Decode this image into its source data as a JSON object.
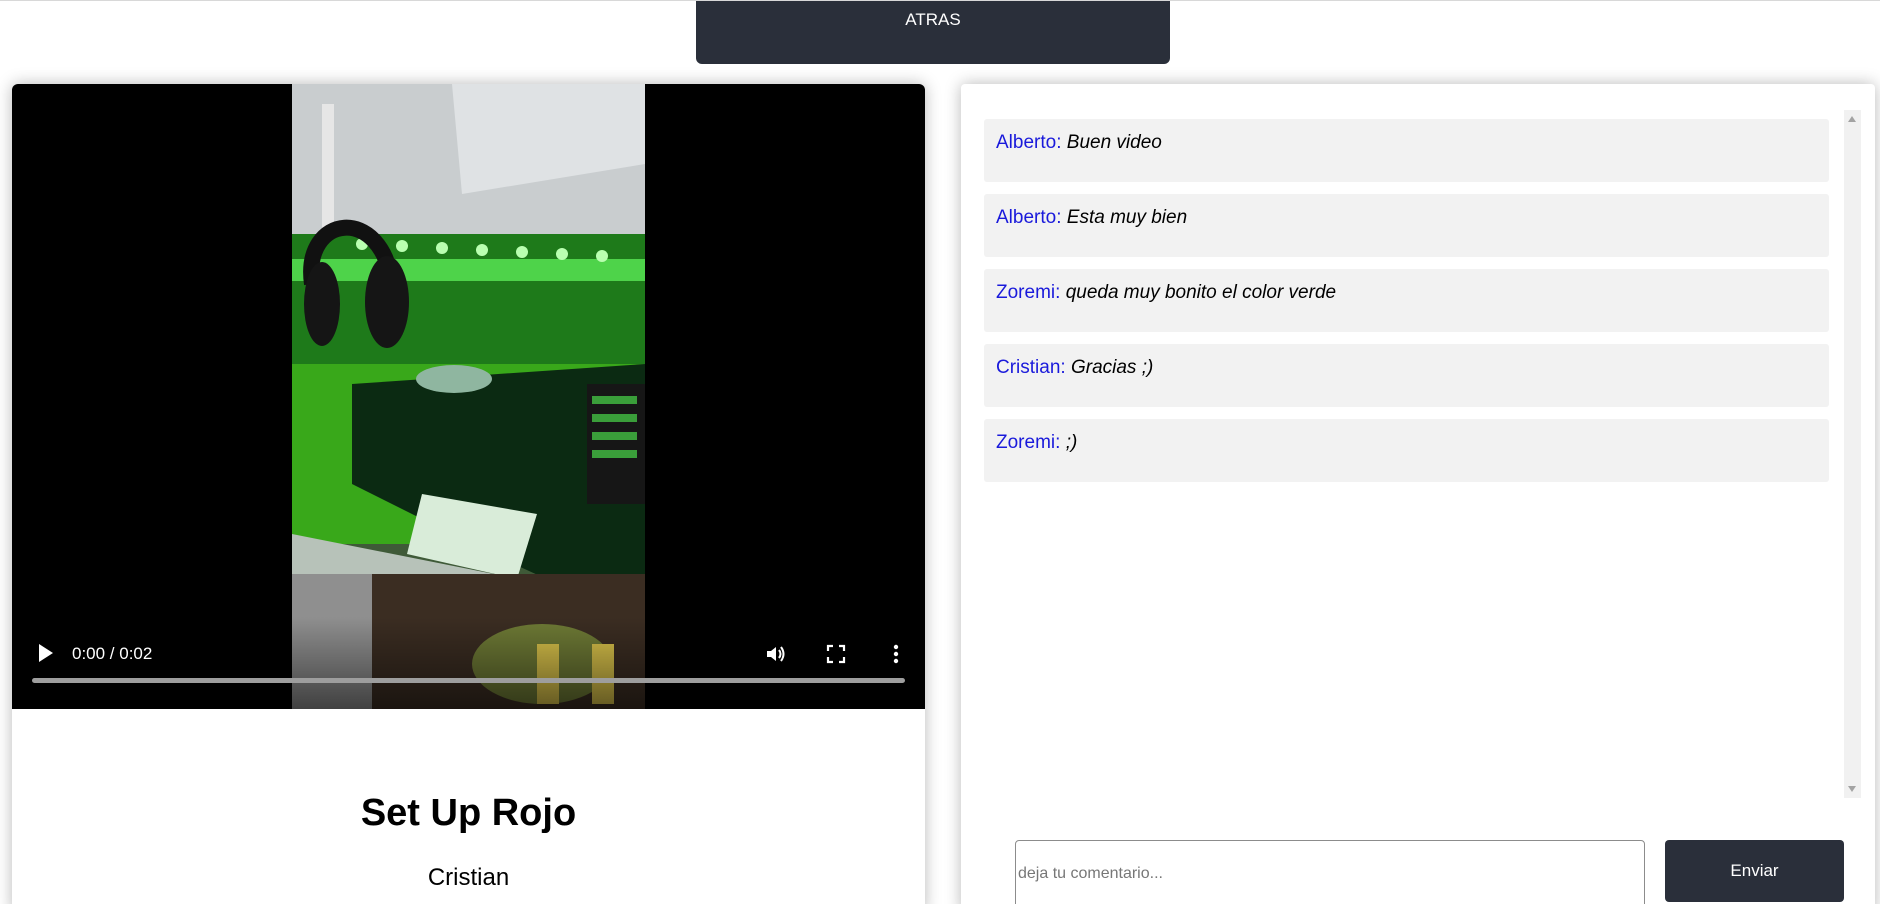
{
  "header": {
    "back_label": "ATRAS"
  },
  "video": {
    "current_time": "0:00",
    "duration": "0:02",
    "time_display": "0:00 / 0:02",
    "progress": 0,
    "title": "Set Up Rojo",
    "author": "Cristian"
  },
  "comments": [
    {
      "author": "Alberto",
      "text": "Buen video"
    },
    {
      "author": "Alberto",
      "text": "Esta muy bien"
    },
    {
      "author": "Zoremi",
      "text": "queda muy bonito el color verde"
    },
    {
      "author": "Cristian",
      "text": "Gracias ;)"
    },
    {
      "author": "Zoremi",
      "text": ";)"
    }
  ],
  "comment_form": {
    "placeholder": "deja tu comentario...",
    "value": "",
    "send_label": "Enviar"
  },
  "colors": {
    "dark_button": "#2a2f3a",
    "author_link": "#1a1adb",
    "comment_bg": "#f2f2f2"
  }
}
